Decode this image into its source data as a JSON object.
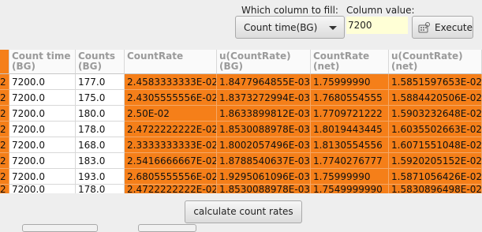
{
  "toolbar": {
    "fill_label": "Which column to fill:",
    "value_label": "Column value:",
    "fill_selected": "Count time(BG)",
    "value": "7200",
    "execute_label": "Execute"
  },
  "table": {
    "columns": [
      {
        "label": "",
        "row_prefix": "2"
      },
      {
        "label": "Count time (BG)"
      },
      {
        "label": "Counts (BG)"
      },
      {
        "label": "CountRate"
      },
      {
        "label": "u(CountRate) (BG)"
      },
      {
        "label": "CountRate (net)"
      },
      {
        "label": "u(CountRate) (net)"
      }
    ],
    "rows": [
      [
        "2",
        "7200.0",
        "177.0",
        "2.4583333333E-02",
        "1.8477964855E-03",
        "1.75999990",
        "1.5851597653E-02"
      ],
      [
        "2",
        "7200.0",
        "175.0",
        "2.4305555556E-02",
        "1.8373272994E-03",
        "1.7680554555",
        "1.5884420506E-02"
      ],
      [
        "2",
        "7200.0",
        "180.0",
        "2.50E-02",
        "1.8633899812E-03",
        "1.7709721222",
        "1.5903232648E-02"
      ],
      [
        "2",
        "7200.0",
        "178.0",
        "2.4722222222E-02",
        "1.8530088978E-03",
        "1.8019443445",
        "1.6035502663E-02"
      ],
      [
        "2",
        "7200.0",
        "168.0",
        "2.3333333333E-02",
        "1.8002057496E-03",
        "1.8130554556",
        "1.6071551048E-02"
      ],
      [
        "2",
        "7200.0",
        "183.0",
        "2.5416666667E-02",
        "1.8788540637E-03",
        "1.7740276777",
        "1.5920205152E-02"
      ],
      [
        "2",
        "7200.0",
        "193.0",
        "2.6805555556E-02",
        "1.9295061096E-03",
        "1.75999990",
        "1.5871056426E-02"
      ],
      [
        "2",
        "7200.0",
        "178.0",
        "2.4722222222E-02",
        "1.8530088978E-03",
        "1.7549999990",
        "1.5830896498E-02"
      ]
    ]
  },
  "calc_label": "calculate count rates",
  "colors": {
    "highlight": "#f57f19",
    "input_bg": "#ffffd6",
    "header_text": "#9a9a9a"
  }
}
